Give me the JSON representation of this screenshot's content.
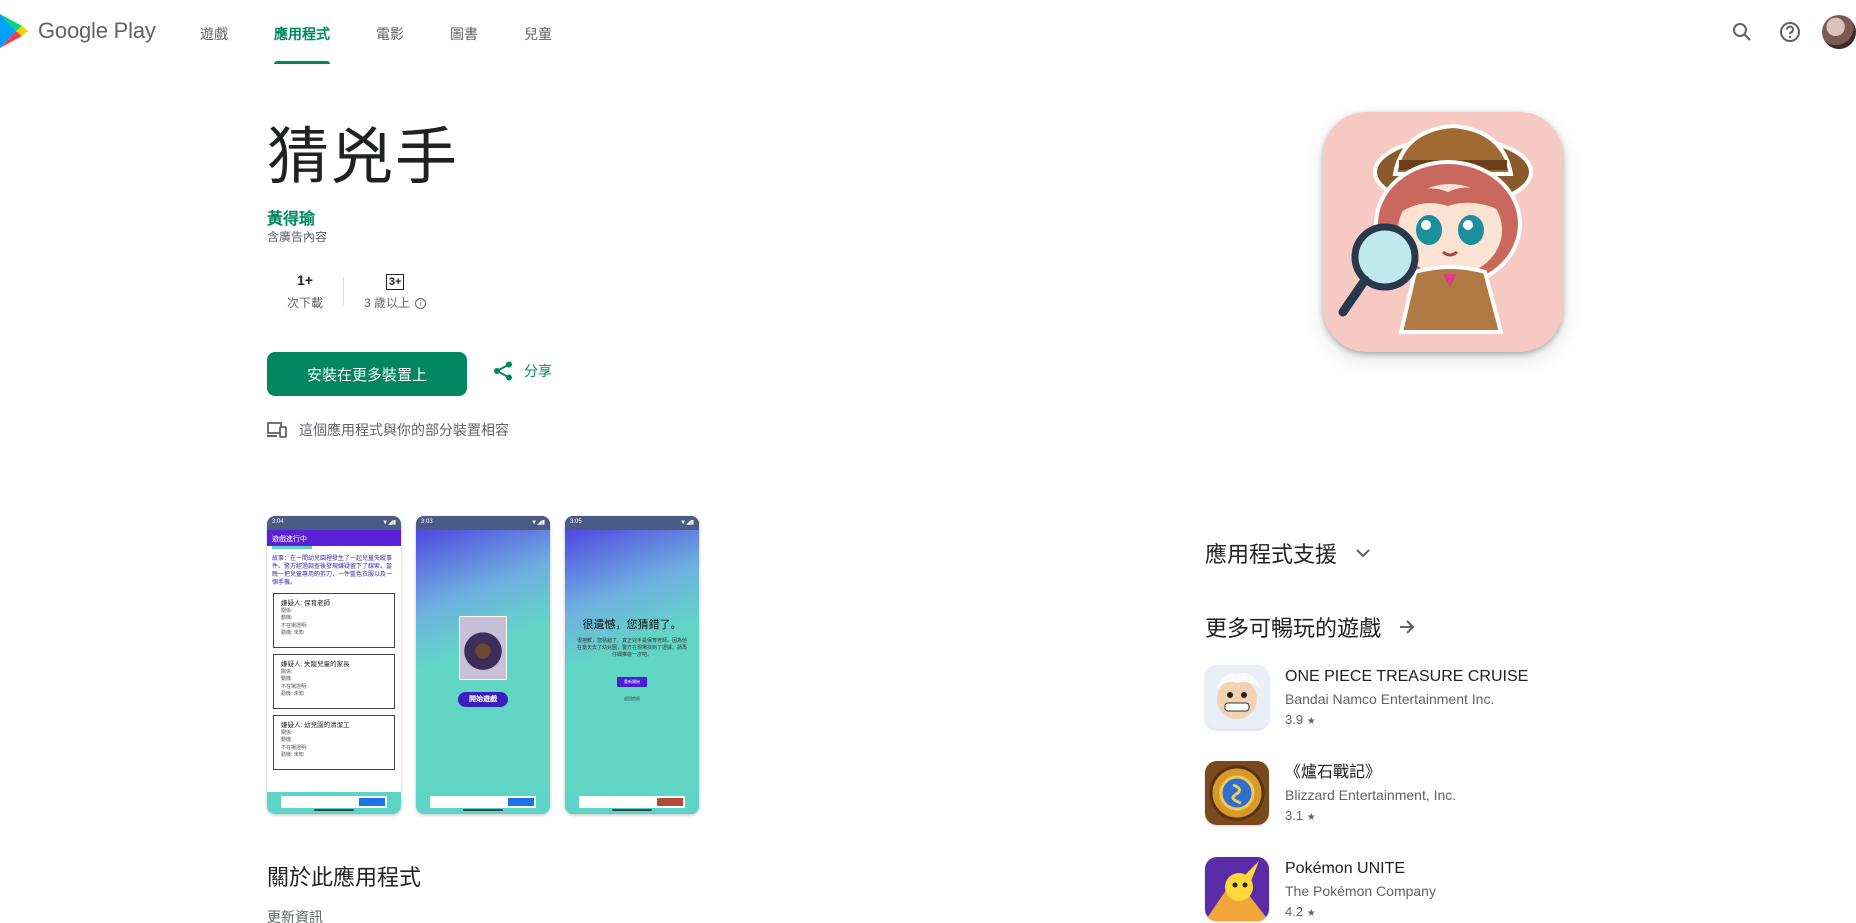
{
  "header": {
    "logo_text": "Google Play",
    "nav": [
      "遊戲",
      "應用程式",
      "電影",
      "圖書",
      "兒童"
    ],
    "active_nav": "應用程式",
    "icons": [
      "search-icon",
      "help-icon",
      "avatar"
    ]
  },
  "app": {
    "title": "猜兇手",
    "developer": "黃得瑜",
    "ads_note": "含廣告內容",
    "downloads_value": "1+",
    "downloads_label": "次下載",
    "content_rating_badge": "3+",
    "content_rating_label": "3 歲以上",
    "install_label": "安裝在更多裝置上",
    "share_label": "分享",
    "compat_note": "這個應用程式與你的部分裝置相容"
  },
  "screenshots": {
    "shot1": {
      "status_time": "3:04",
      "bar_title": "遊戲進行中",
      "story": "故事：在一間幼兒園裡發生了一起兒童失蹤事件。警方經過調查後發現嫌疑留下了線索。當晚一把兒童專用的剪刀，一件藍色衣服以及一個手機。",
      "cards": [
        {
          "title": "嫌疑人: 保育老師",
          "lines": [
            "關係:",
            "動機:",
            "不在場證明:",
            "勤機: 未知"
          ]
        },
        {
          "title": "嫌疑人: 失蹤兒童的家長",
          "lines": [
            "關係:",
            "動機:",
            "不在場證明:",
            "勤機: 未知"
          ]
        },
        {
          "title": "嫌疑人: 幼兒園的清潔工",
          "lines": [
            "關係:",
            "動機:",
            "不在場證明:",
            "勤機: 未知"
          ]
        }
      ]
    },
    "shot2": {
      "status_time": "3:03",
      "button": "開始遊戲"
    },
    "shot3": {
      "status_time": "3:05",
      "title": "很遺憾，您猜錯了。",
      "text": "很抱歉，您猜錯了。真正兇手是保育老師。因為他在當天去了幼兒園，警方在現場找到了證據。請再仔細推敲一次吧。",
      "button": "重新開始",
      "button2": "返回首頁"
    }
  },
  "about_title": "關於此應用程式",
  "updates_label": "更新資訊",
  "support_label": "應用程式支援",
  "more_games_label": "更多可暢玩的遊戲",
  "games": [
    {
      "name": "ONE PIECE TREASURE CRUISE",
      "dev": "Bandai Namco Entertainment Inc.",
      "rating": "3.9"
    },
    {
      "name": "《爐石戰記》",
      "dev": "Blizzard Entertainment, Inc.",
      "rating": "3.1"
    },
    {
      "name": "Pokémon UNITE",
      "dev": "The Pokémon Company",
      "rating": "4.2"
    }
  ],
  "colors": {
    "accent": "#01875f",
    "text": "#202124",
    "secondary": "#5f6368"
  }
}
